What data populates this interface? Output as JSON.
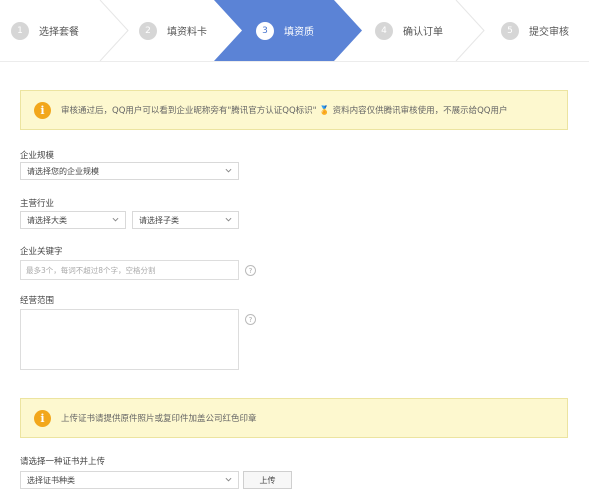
{
  "steps": [
    {
      "num": "1",
      "label": "选择套餐"
    },
    {
      "num": "2",
      "label": "填资料卡"
    },
    {
      "num": "3",
      "label": "填资质"
    },
    {
      "num": "4",
      "label": "确认订单"
    },
    {
      "num": "5",
      "label": "提交审核"
    }
  ],
  "active_step": "3",
  "colors": {
    "active_step": "#5b83d6",
    "notice_bg": "#fdf8cf",
    "info_icon": "#f2a71c"
  },
  "notice_top": {
    "text": "审核通过后，QQ用户可以看到企业昵称旁有\"腾讯官方认证QQ标识\" 🏅 资料内容仅供腾讯审核使用，不展示给QQ用户"
  },
  "form": {
    "scale": {
      "label": "企业规模",
      "value": "请选择您的企业规模"
    },
    "industry": {
      "label": "主营行业",
      "major": "请选择大类",
      "minor": "请选择子类"
    },
    "keywords": {
      "label": "企业关键字",
      "placeholder": "最多3个，每词不超过8个字，空格分割"
    },
    "scope": {
      "label": "经营范围"
    },
    "help_glyph": "?"
  },
  "notice_bottom": {
    "text": "上传证书请提供原件照片或复印件加盖公司红色印章"
  },
  "upload": {
    "label": "请选择一种证书并上传",
    "select": "选择证书种类",
    "button": "上传"
  }
}
